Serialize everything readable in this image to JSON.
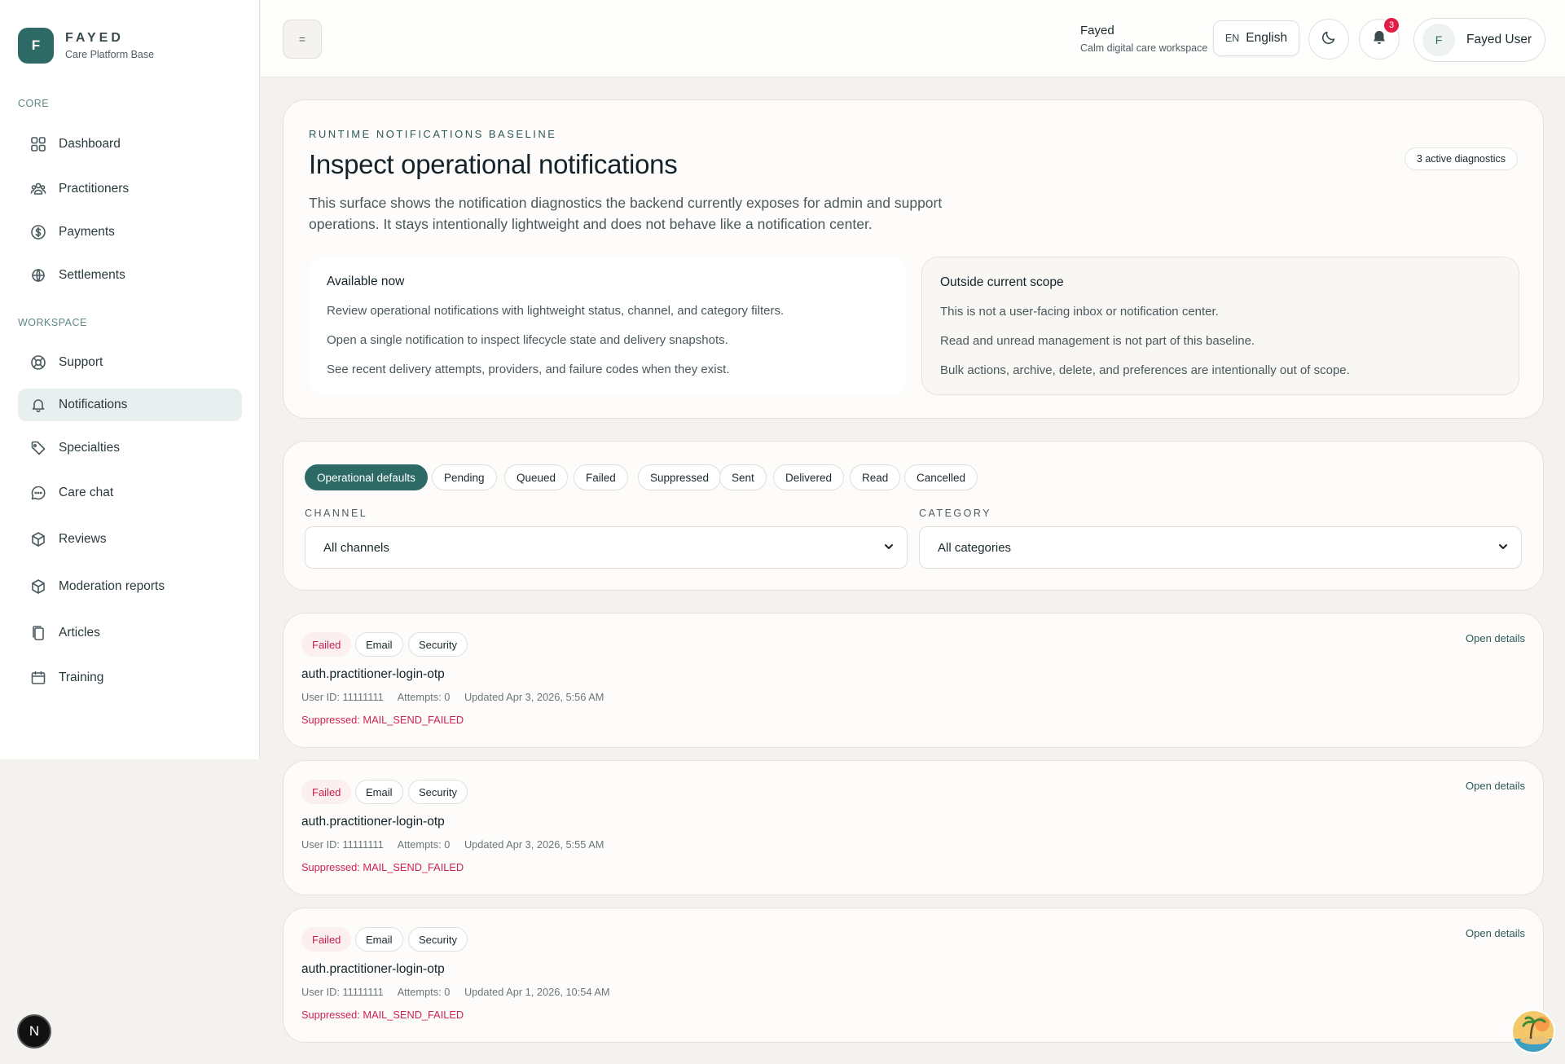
{
  "brand": {
    "logo_letter": "F",
    "name": "FAYED",
    "subtitle": "Care Platform Base"
  },
  "sidebar": {
    "sections": [
      {
        "label": "CORE",
        "items": [
          {
            "label": "Dashboard",
            "icon": "grid-icon"
          },
          {
            "label": "Practitioners",
            "icon": "users-icon"
          },
          {
            "label": "Payments",
            "icon": "dollar-circle-icon"
          },
          {
            "label": "Settlements",
            "icon": "globe-icon"
          }
        ]
      },
      {
        "label": "WORKSPACE",
        "items": [
          {
            "label": "Support",
            "icon": "lifebuoy-icon"
          },
          {
            "label": "Notifications",
            "icon": "bell-icon",
            "active": true
          },
          {
            "label": "Specialties",
            "icon": "tag-icon"
          },
          {
            "label": "Care chat",
            "icon": "chat-icon"
          },
          {
            "label": "Reviews",
            "icon": "box-icon"
          },
          {
            "label": "Moderation reports",
            "icon": "box-icon"
          },
          {
            "label": "Articles",
            "icon": "copy-icon"
          },
          {
            "label": "Training",
            "icon": "calendar-icon"
          }
        ]
      }
    ]
  },
  "header": {
    "menu_glyph": "=",
    "workspace_name": "Fayed",
    "workspace_sub": "Calm digital care workspace",
    "lang_code": "EN",
    "lang_label": "English",
    "notification_count": "3",
    "user_initial": "F",
    "user_name": "Fayed User"
  },
  "hero": {
    "eyebrow": "RUNTIME NOTIFICATIONS BASELINE",
    "title": "Inspect operational notifications",
    "diagnostics_pill": "3 active diagnostics",
    "description": "This surface shows the notification diagnostics the backend currently exposes for admin and support operations. It stays intentionally lightweight and does not behave like a notification center.",
    "available": {
      "title": "Available now",
      "items": [
        "Review operational notifications with lightweight status, channel, and category filters.",
        "Open a single notification to inspect lifecycle state and delivery snapshots.",
        "See recent delivery attempts, providers, and failure codes when they exist."
      ]
    },
    "outside": {
      "title": "Outside current scope",
      "items": [
        "This is not a user-facing inbox or notification center.",
        "Read and unread management is not part of this baseline.",
        "Bulk actions, archive, delete, and preferences are intentionally out of scope."
      ]
    }
  },
  "filters": {
    "chips": [
      "Operational defaults",
      "Pending",
      "Queued",
      "Failed",
      "Suppressed",
      "Sent",
      "Delivered",
      "Read",
      "Cancelled"
    ],
    "active_chip": "Operational defaults",
    "channel_label": "CHANNEL",
    "channel_value": "All channels",
    "category_label": "CATEGORY",
    "category_value": "All categories"
  },
  "notifications": [
    {
      "status": "Failed",
      "channel": "Email",
      "category": "Security",
      "title": "auth.practitioner-login-otp",
      "user_id": "User ID: 11111111",
      "attempts": "Attempts: 0",
      "updated": "Updated Apr 3, 2026, 5:56 AM",
      "error": "Suppressed: MAIL_SEND_FAILED",
      "link": "Open details"
    },
    {
      "status": "Failed",
      "channel": "Email",
      "category": "Security",
      "title": "auth.practitioner-login-otp",
      "user_id": "User ID: 11111111",
      "attempts": "Attempts: 0",
      "updated": "Updated Apr 3, 2026, 5:55 AM",
      "error": "Suppressed: MAIL_SEND_FAILED",
      "link": "Open details"
    },
    {
      "status": "Failed",
      "channel": "Email",
      "category": "Security",
      "title": "auth.practitioner-login-otp",
      "user_id": "User ID: 11111111",
      "attempts": "Attempts: 0",
      "updated": "Updated Apr 1, 2026, 10:54 AM",
      "error": "Suppressed: MAIL_SEND_FAILED",
      "link": "Open details"
    }
  ],
  "floating": {
    "dev_badge": "N"
  },
  "colors": {
    "accent": "#2d6a66",
    "danger": "#e11d48",
    "failed_text": "#c81e4a",
    "background": "#f4f2ee"
  }
}
